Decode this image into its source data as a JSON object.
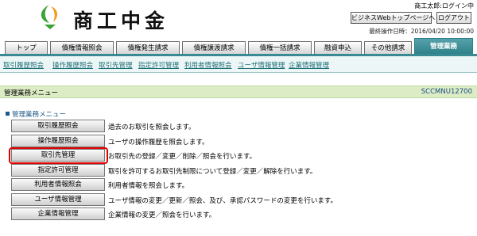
{
  "header": {
    "logo_text": "商工中金",
    "user_name": "商工太郎:ログイン中",
    "biz_button_label": "ビジネスWebトップページへ",
    "logout_label": "ログアウト",
    "last_operation": "最終操作日時：2016/04/20 10:00:00"
  },
  "tabs": [
    {
      "label": "トップ"
    },
    {
      "label": "債権情報照会"
    },
    {
      "label": "債権発生請求"
    },
    {
      "label": "債権譲渡請求"
    },
    {
      "label": "債権一括請求"
    },
    {
      "label": "融資申込"
    },
    {
      "label": "その他請求"
    },
    {
      "label": "管理業務"
    }
  ],
  "subnav": [
    {
      "label": "取引履歴照会"
    },
    {
      "label": "操作履歴照会"
    },
    {
      "label": "取引先管理"
    },
    {
      "label": "指定許可管理"
    },
    {
      "label": "利用者情報照会"
    },
    {
      "label": "ユーザ情報管理"
    },
    {
      "label": "企業情報管理"
    }
  ],
  "page": {
    "title": "管理業務メニュー",
    "screen_id": "SCCMNU12700",
    "section_title": "管理業務メニュー"
  },
  "menu": [
    {
      "label": "取引履歴照会",
      "description": "過去のお取引を照会します。"
    },
    {
      "label": "操作履歴照会",
      "description": "ユーザの操作履歴を照会します。"
    },
    {
      "label": "取引先管理",
      "description": "お取引先の登録／変更／削除／照会を行います。"
    },
    {
      "label": "指定許可管理",
      "description": "取引を許可するお取引先制限について登録／変更／解除を行います。"
    },
    {
      "label": "利用者情報照会",
      "description": "利用者情報を照会します。"
    },
    {
      "label": "ユーザ情報管理",
      "description": "ユーザ情報の変更／更新／照会、及び、承認パスワードの変更を行います。"
    },
    {
      "label": "企業情報管理",
      "description": "企業情報の変更／照会を行います。"
    }
  ],
  "colors": {
    "accent": "#2c7f89",
    "highlight": "#e00000",
    "title_bar": "#dcecc4",
    "logo_green": "#3aa336",
    "logo_orange": "#f39a1e"
  }
}
